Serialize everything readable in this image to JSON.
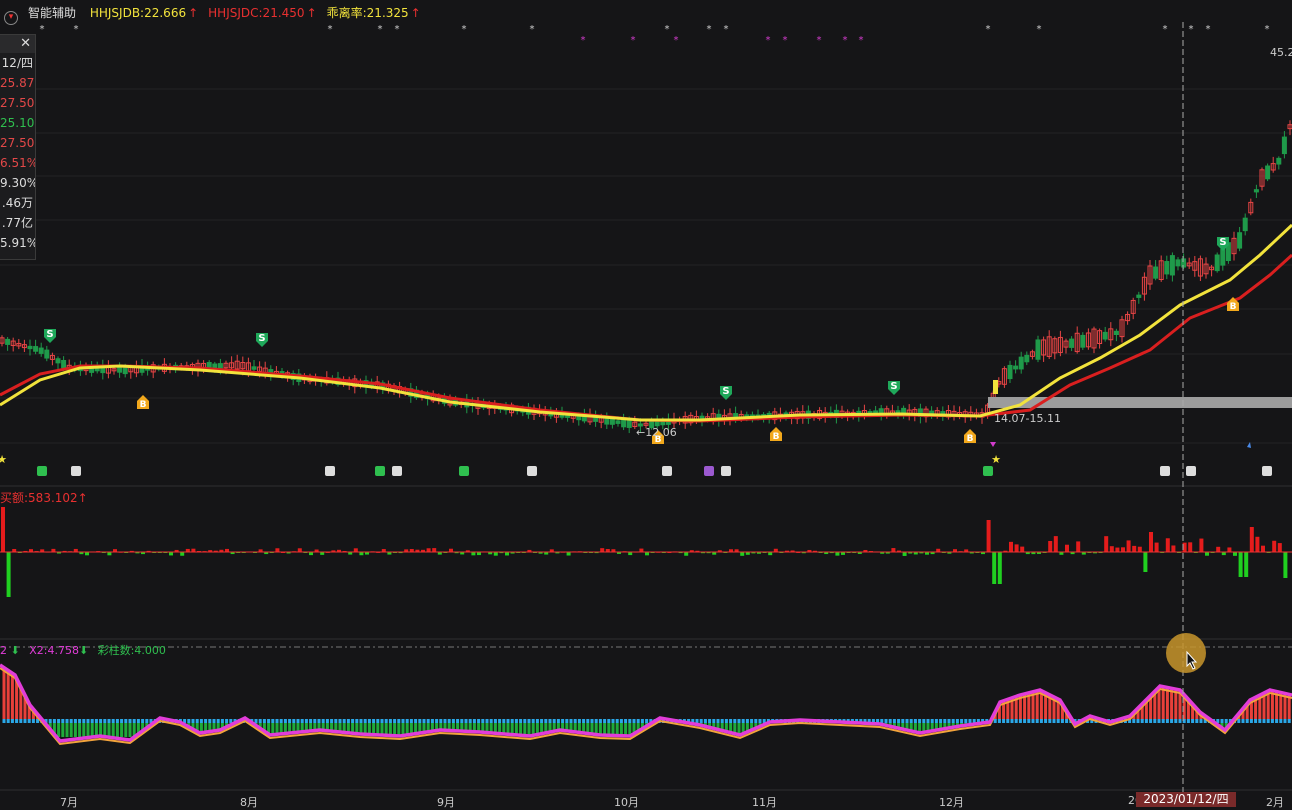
{
  "header": {
    "menu_label": "智能辅助",
    "items": [
      {
        "label": "HHJSJDB:22.666",
        "arrow": "↑",
        "color": "#f2e33c"
      },
      {
        "label": "HHJSJDC:21.450",
        "arrow": "↑",
        "color": "#e83030"
      },
      {
        "label": "乖离率:21.325",
        "arrow": "↑",
        "color": "#f2e33c"
      }
    ]
  },
  "info_panel": {
    "close_label": "✕",
    "rows": [
      {
        "text": "12/四",
        "color": "#dddddd"
      },
      {
        "text": "25.87",
        "color": "#e34848"
      },
      {
        "text": "27.50",
        "color": "#e34848"
      },
      {
        "text": "25.10",
        "color": "#2fbf4f"
      },
      {
        "text": "27.50",
        "color": "#e34848"
      },
      {
        "text": "6.51%",
        "color": "#e34848"
      },
      {
        "text": "9.30%",
        "color": "#dddddd"
      },
      {
        "text": ".46万",
        "color": "#dddddd"
      },
      {
        "text": ".77亿",
        "color": "#dddddd"
      },
      {
        "text": "5.91%",
        "color": "#dddddd"
      }
    ]
  },
  "price_labels": {
    "top_right": "45.2",
    "low": "12.06",
    "range": "14.07-15.11"
  },
  "volume_title": "买额:583.102",
  "volume_arrow": "↑",
  "osc_title": {
    "prefix": "2",
    "x2": "X2:4.758",
    "bars": "彩柱数:4.000"
  },
  "x_axis": [
    "7月",
    "8月",
    "9月",
    "10月",
    "11月",
    "12月",
    "20",
    "2月"
  ],
  "cursor_date": "2023/01/12/四",
  "signal_labels": {
    "buy": "B",
    "sell": "S"
  },
  "colors": {
    "up": "#e84545",
    "down": "#1f9a4a",
    "ma1": "#f2e33c",
    "ma2": "#d91f1f",
    "osc_line": "#e23cd9"
  },
  "chart_data": {
    "type": "candlestick",
    "x_range": [
      "2022-06",
      "2023-02"
    ],
    "y_range_visible": [
      12.06,
      45.2
    ],
    "series": [
      {
        "name": "HHJSJDB",
        "last": 22.666
      },
      {
        "name": "HHJSJDC",
        "last": 21.45
      }
    ],
    "volume_last": 583.102,
    "oscillator": {
      "X2": 4.758,
      "bars": 4.0
    }
  }
}
